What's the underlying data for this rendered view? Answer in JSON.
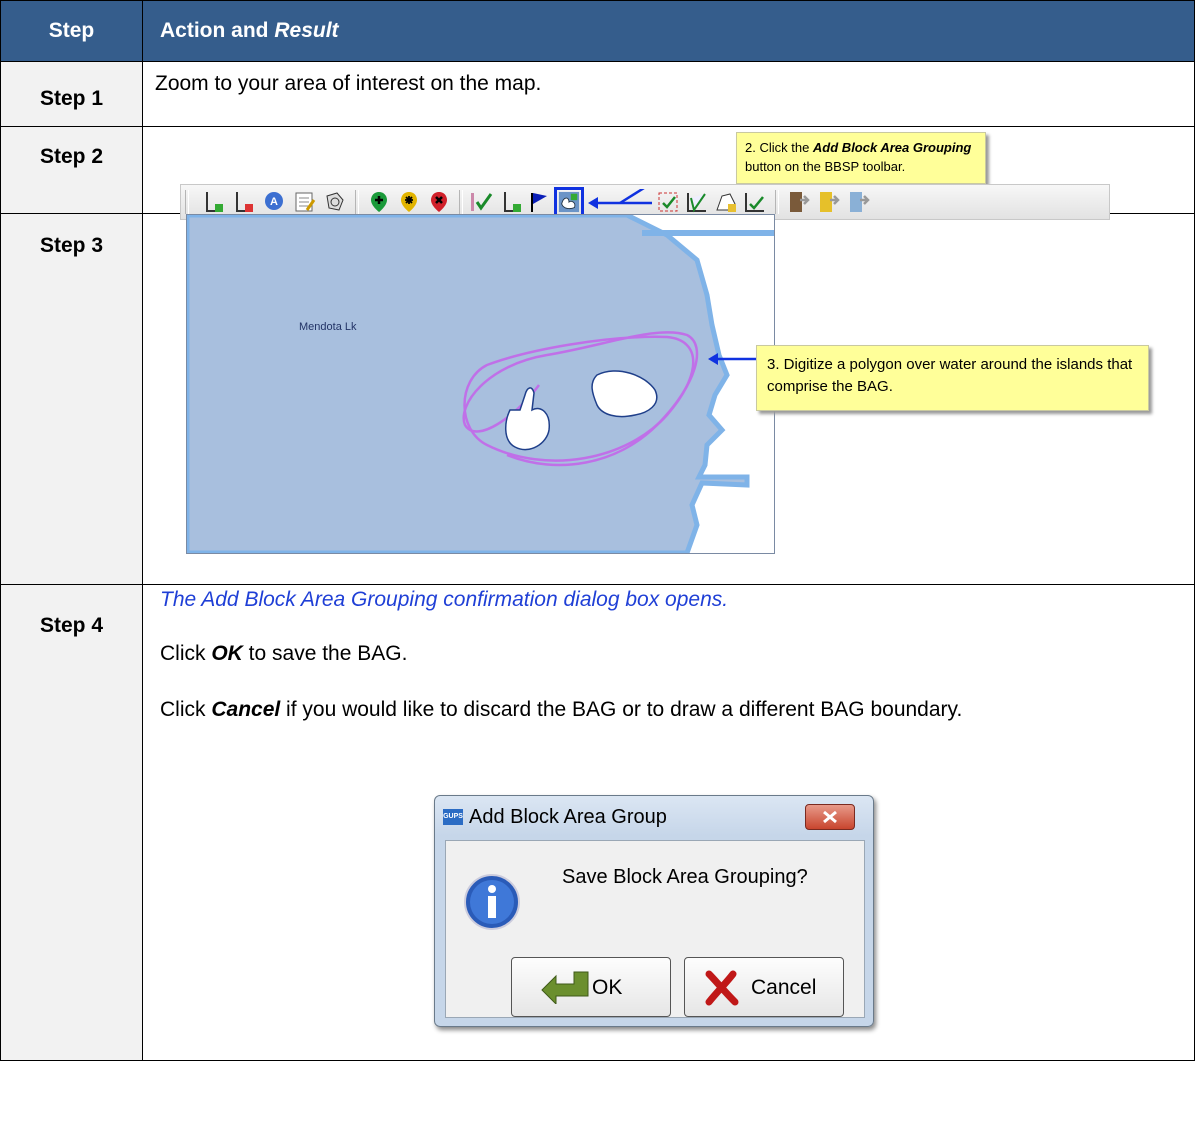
{
  "header": {
    "step": "Step",
    "action_prefix": "Action and ",
    "action_italic": "Result"
  },
  "steps": [
    {
      "label": "Step 1",
      "text": "Zoom to your area of interest on the map."
    },
    {
      "label": "Step 2",
      "callout_prefix": "2. Click the ",
      "callout_bold": "Add Block Area Grouping",
      "callout_suffix": " button on the BBSP toolbar."
    },
    {
      "label": "Step 3",
      "map_label": "Mendota Lk",
      "callout": "3. Digitize a polygon over water around the islands that comprise the BAG."
    },
    {
      "label": "Step 4",
      "result": "The Add Block Area Grouping confirmation dialog box opens.",
      "ok_pre": "Click ",
      "ok_bold": "OK",
      "ok_post": " to save the BAG.",
      "cancel_pre": "Click ",
      "cancel_bold": "Cancel",
      "cancel_post": " if you would like to discard the BAG or to draw a different BAG boundary.",
      "dialog": {
        "title": "Add Block Area Group",
        "app_badge": "GUPS",
        "message": "Save Block Area Grouping?",
        "ok": "OK",
        "cancel": "Cancel"
      }
    }
  ],
  "colors": {
    "header_bg": "#355d8c",
    "result_text": "#1f3fd6",
    "water": "#a8bfde",
    "callout_bg": "#ffff99"
  }
}
